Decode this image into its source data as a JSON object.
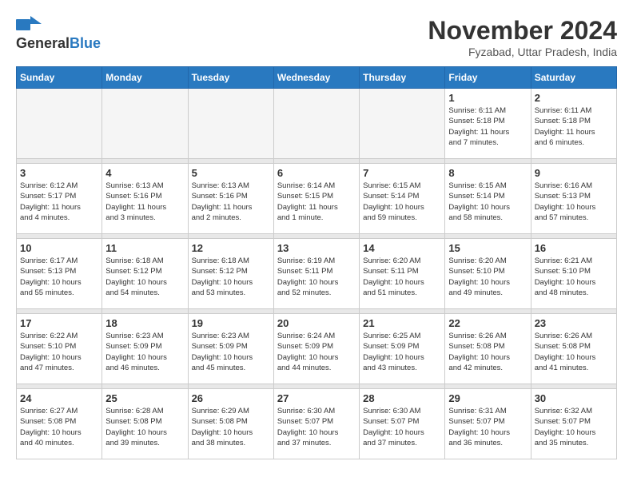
{
  "header": {
    "logo_general": "General",
    "logo_blue": "Blue",
    "month_year": "November 2024",
    "location": "Fyzabad, Uttar Pradesh, India"
  },
  "weekdays": [
    "Sunday",
    "Monday",
    "Tuesday",
    "Wednesday",
    "Thursday",
    "Friday",
    "Saturday"
  ],
  "weeks": [
    [
      {
        "day": "",
        "info": ""
      },
      {
        "day": "",
        "info": ""
      },
      {
        "day": "",
        "info": ""
      },
      {
        "day": "",
        "info": ""
      },
      {
        "day": "",
        "info": ""
      },
      {
        "day": "1",
        "info": "Sunrise: 6:11 AM\nSunset: 5:18 PM\nDaylight: 11 hours\nand 7 minutes."
      },
      {
        "day": "2",
        "info": "Sunrise: 6:11 AM\nSunset: 5:18 PM\nDaylight: 11 hours\nand 6 minutes."
      }
    ],
    [
      {
        "day": "3",
        "info": "Sunrise: 6:12 AM\nSunset: 5:17 PM\nDaylight: 11 hours\nand 4 minutes."
      },
      {
        "day": "4",
        "info": "Sunrise: 6:13 AM\nSunset: 5:16 PM\nDaylight: 11 hours\nand 3 minutes."
      },
      {
        "day": "5",
        "info": "Sunrise: 6:13 AM\nSunset: 5:16 PM\nDaylight: 11 hours\nand 2 minutes."
      },
      {
        "day": "6",
        "info": "Sunrise: 6:14 AM\nSunset: 5:15 PM\nDaylight: 11 hours\nand 1 minute."
      },
      {
        "day": "7",
        "info": "Sunrise: 6:15 AM\nSunset: 5:14 PM\nDaylight: 10 hours\nand 59 minutes."
      },
      {
        "day": "8",
        "info": "Sunrise: 6:15 AM\nSunset: 5:14 PM\nDaylight: 10 hours\nand 58 minutes."
      },
      {
        "day": "9",
        "info": "Sunrise: 6:16 AM\nSunset: 5:13 PM\nDaylight: 10 hours\nand 57 minutes."
      }
    ],
    [
      {
        "day": "10",
        "info": "Sunrise: 6:17 AM\nSunset: 5:13 PM\nDaylight: 10 hours\nand 55 minutes."
      },
      {
        "day": "11",
        "info": "Sunrise: 6:18 AM\nSunset: 5:12 PM\nDaylight: 10 hours\nand 54 minutes."
      },
      {
        "day": "12",
        "info": "Sunrise: 6:18 AM\nSunset: 5:12 PM\nDaylight: 10 hours\nand 53 minutes."
      },
      {
        "day": "13",
        "info": "Sunrise: 6:19 AM\nSunset: 5:11 PM\nDaylight: 10 hours\nand 52 minutes."
      },
      {
        "day": "14",
        "info": "Sunrise: 6:20 AM\nSunset: 5:11 PM\nDaylight: 10 hours\nand 51 minutes."
      },
      {
        "day": "15",
        "info": "Sunrise: 6:20 AM\nSunset: 5:10 PM\nDaylight: 10 hours\nand 49 minutes."
      },
      {
        "day": "16",
        "info": "Sunrise: 6:21 AM\nSunset: 5:10 PM\nDaylight: 10 hours\nand 48 minutes."
      }
    ],
    [
      {
        "day": "17",
        "info": "Sunrise: 6:22 AM\nSunset: 5:10 PM\nDaylight: 10 hours\nand 47 minutes."
      },
      {
        "day": "18",
        "info": "Sunrise: 6:23 AM\nSunset: 5:09 PM\nDaylight: 10 hours\nand 46 minutes."
      },
      {
        "day": "19",
        "info": "Sunrise: 6:23 AM\nSunset: 5:09 PM\nDaylight: 10 hours\nand 45 minutes."
      },
      {
        "day": "20",
        "info": "Sunrise: 6:24 AM\nSunset: 5:09 PM\nDaylight: 10 hours\nand 44 minutes."
      },
      {
        "day": "21",
        "info": "Sunrise: 6:25 AM\nSunset: 5:09 PM\nDaylight: 10 hours\nand 43 minutes."
      },
      {
        "day": "22",
        "info": "Sunrise: 6:26 AM\nSunset: 5:08 PM\nDaylight: 10 hours\nand 42 minutes."
      },
      {
        "day": "23",
        "info": "Sunrise: 6:26 AM\nSunset: 5:08 PM\nDaylight: 10 hours\nand 41 minutes."
      }
    ],
    [
      {
        "day": "24",
        "info": "Sunrise: 6:27 AM\nSunset: 5:08 PM\nDaylight: 10 hours\nand 40 minutes."
      },
      {
        "day": "25",
        "info": "Sunrise: 6:28 AM\nSunset: 5:08 PM\nDaylight: 10 hours\nand 39 minutes."
      },
      {
        "day": "26",
        "info": "Sunrise: 6:29 AM\nSunset: 5:08 PM\nDaylight: 10 hours\nand 38 minutes."
      },
      {
        "day": "27",
        "info": "Sunrise: 6:30 AM\nSunset: 5:07 PM\nDaylight: 10 hours\nand 37 minutes."
      },
      {
        "day": "28",
        "info": "Sunrise: 6:30 AM\nSunset: 5:07 PM\nDaylight: 10 hours\nand 37 minutes."
      },
      {
        "day": "29",
        "info": "Sunrise: 6:31 AM\nSunset: 5:07 PM\nDaylight: 10 hours\nand 36 minutes."
      },
      {
        "day": "30",
        "info": "Sunrise: 6:32 AM\nSunset: 5:07 PM\nDaylight: 10 hours\nand 35 minutes."
      }
    ]
  ]
}
